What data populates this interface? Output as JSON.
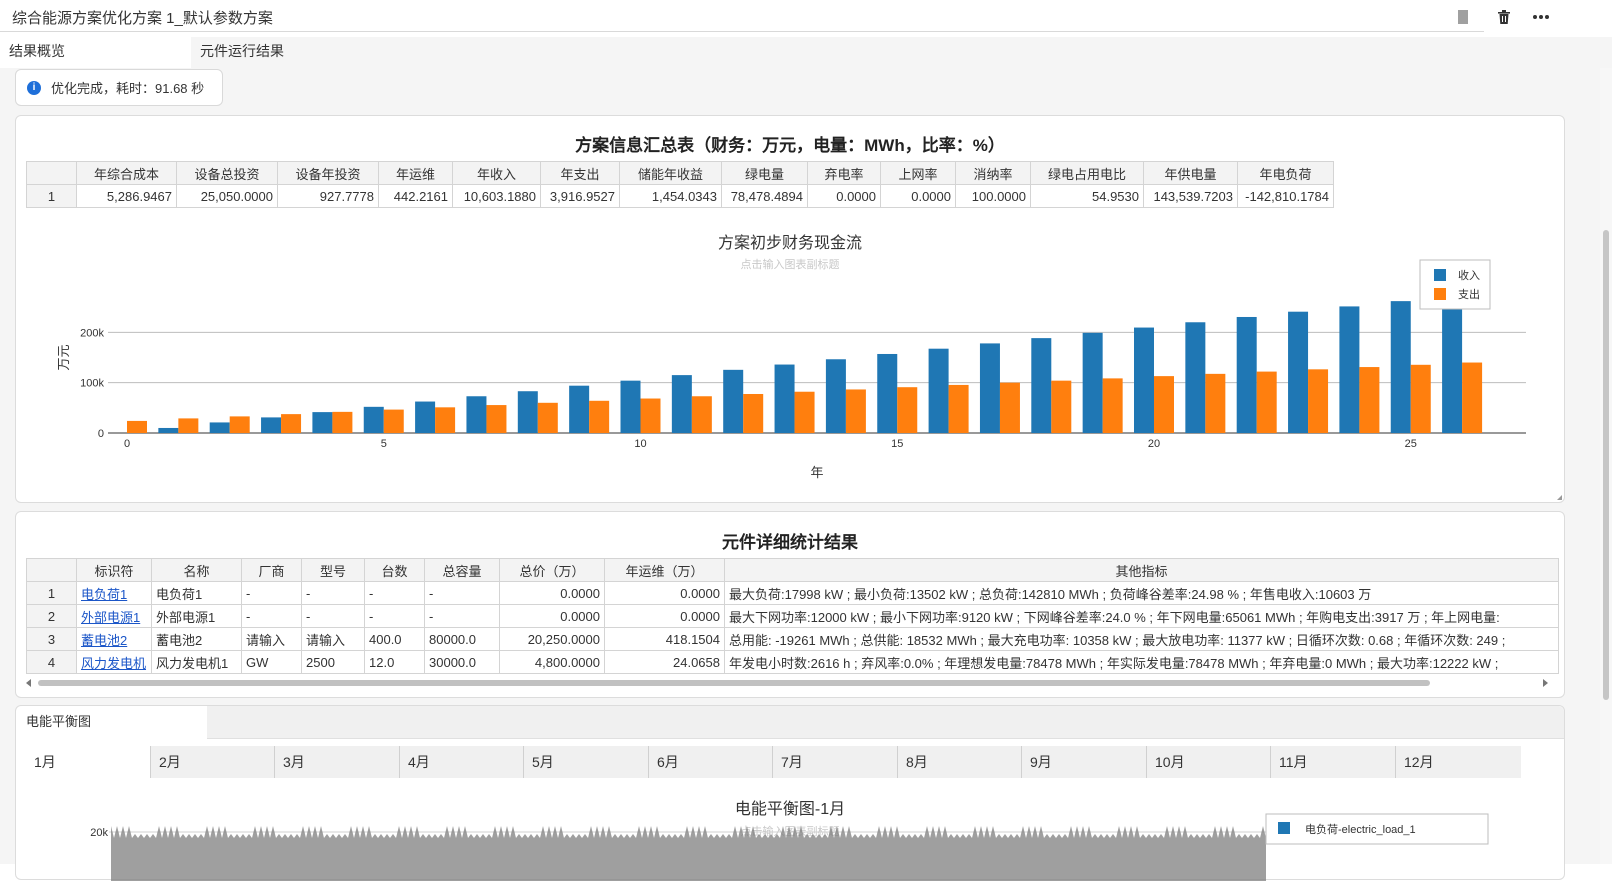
{
  "window": {
    "title": "综合能源方案优化方案 1_默认参数方案"
  },
  "tabs": [
    {
      "label": "结果概览",
      "active": true
    },
    {
      "label": "元件运行结果",
      "active": false
    }
  ],
  "notice": {
    "text": "优化完成，耗时：91.68 秒"
  },
  "summary": {
    "title": "方案信息汇总表（财务：万元，电量：MWh，比率：%）",
    "columns": [
      "",
      "年综合成本",
      "设备总投资",
      "设备年投资",
      "年运维",
      "年收入",
      "年支出",
      "储能年收益",
      "绿电量",
      "弃电率",
      "上网率",
      "消纳率",
      "绿电占用电比",
      "年供电量",
      "年电负荷"
    ],
    "rows": [
      [
        "1",
        "5,286.9467",
        "25,050.0000",
        "927.7778",
        "442.2161",
        "10,603.1880",
        "3,916.9527",
        "1,454.0343",
        "78,478.4894",
        "0.0000",
        "0.0000",
        "100.0000",
        "54.9530",
        "143,539.7203",
        "-142,810.1784"
      ]
    ]
  },
  "chart_data": [
    {
      "type": "bar",
      "title": "方案初步财务现金流",
      "subtitle": "点击输入图表副标题",
      "xlabel": "年",
      "ylabel": "万元",
      "ylim": [
        0,
        300000
      ],
      "yticks": [
        0,
        100000,
        200000
      ],
      "ytick_labels": [
        "0",
        "100k",
        "200k"
      ],
      "xticks": [
        0,
        5,
        10,
        15,
        20,
        25
      ],
      "legend_position": "top-right",
      "categories": [
        0,
        1,
        2,
        3,
        4,
        5,
        6,
        7,
        8,
        9,
        10,
        11,
        12,
        13,
        14,
        15,
        16,
        17,
        18,
        19,
        20,
        21,
        22,
        23,
        24,
        25,
        26
      ],
      "series": [
        {
          "name": "收入",
          "color": "#1f77b4",
          "values": [
            0,
            10000,
            21000,
            31000,
            41500,
            52000,
            62500,
            73000,
            83000,
            94000,
            104000,
            115000,
            125500,
            136000,
            146500,
            157000,
            167500,
            178000,
            188500,
            199000,
            209500,
            220000,
            230500,
            241000,
            251500,
            262000,
            272000
          ]
        },
        {
          "name": "支出",
          "color": "#ff7f0e",
          "values": [
            24000,
            29000,
            33000,
            37500,
            42000,
            46500,
            51000,
            55500,
            60000,
            64000,
            68500,
            73000,
            77500,
            82000,
            86500,
            91000,
            95500,
            100000,
            104000,
            108500,
            113000,
            117500,
            122000,
            126500,
            131000,
            135500,
            140000
          ]
        }
      ]
    },
    {
      "type": "line",
      "title": "电能平衡图-1月",
      "subtitle": "点击输入图表副标题",
      "ytick_labels": [
        "20k"
      ],
      "legend_position": "top-right",
      "series": [
        {
          "name": "电负荷-electric_load_1",
          "color": "#1f77b4"
        }
      ]
    }
  ],
  "details": {
    "title": "元件详细统计结果",
    "columns": [
      "",
      "标识符",
      "名称",
      "厂商",
      "型号",
      "台数",
      "总容量",
      "总价（万）",
      "年运维（万）",
      "其他指标"
    ],
    "rows": [
      {
        "idx": "1",
        "id": "电负荷1",
        "name": "电负荷1",
        "vendor": "-",
        "model": "-",
        "count": "-",
        "capacity": "-",
        "price": "0.0000",
        "om": "0.0000",
        "other": "最大负荷:17998 kW ; 最小负荷:13502 kW ; 总负荷:142810 MWh ; 负荷峰谷差率:24.98 % ; 年售电收入:10603 万"
      },
      {
        "idx": "2",
        "id": "外部电源1",
        "name": "外部电源1",
        "vendor": "-",
        "model": "-",
        "count": "-",
        "capacity": "-",
        "price": "0.0000",
        "om": "0.0000",
        "other": "最大下网功率:12000 kW ; 最小下网功率:9120 kW ; 下网峰谷差率:24.0 % ; 年下网电量:65061 MWh ; 年购电支出:3917 万 ; 年上网电量:"
      },
      {
        "idx": "3",
        "id": "蓄电池2",
        "name": "蓄电池2",
        "vendor": "请输入",
        "model": "请输入",
        "count": "400.0",
        "capacity": "80000.0",
        "price": "20,250.0000",
        "om": "418.1504",
        "other": "总用能: -19261 MWh ; 总供能: 18532 MWh ; 最大充电功率: 10358 kW ; 最大放电功率: 11377 kW ; 日循环次数: 0.68 ; 年循环次数: 249 ;"
      },
      {
        "idx": "4",
        "id": "风力发电机",
        "name": "风力发电机1",
        "vendor": "GW",
        "model": "2500",
        "count": "12.0",
        "capacity": "30000.0",
        "price": "4,800.0000",
        "om": "24.0658",
        "other": "年发电小时数:2616 h ; 弃风率:0.0% ; 年理想发电量:78478 MWh ; 年实际发电量:78478 MWh ; 年弃电量:0 MWh ; 最大功率:12222 kW ;"
      }
    ]
  },
  "energy": {
    "tab_label": "电能平衡图",
    "months": [
      "1月",
      "2月",
      "3月",
      "4月",
      "5月",
      "6月",
      "7月",
      "8月",
      "9月",
      "10月",
      "11月",
      "12月"
    ],
    "active_month": "1月"
  }
}
